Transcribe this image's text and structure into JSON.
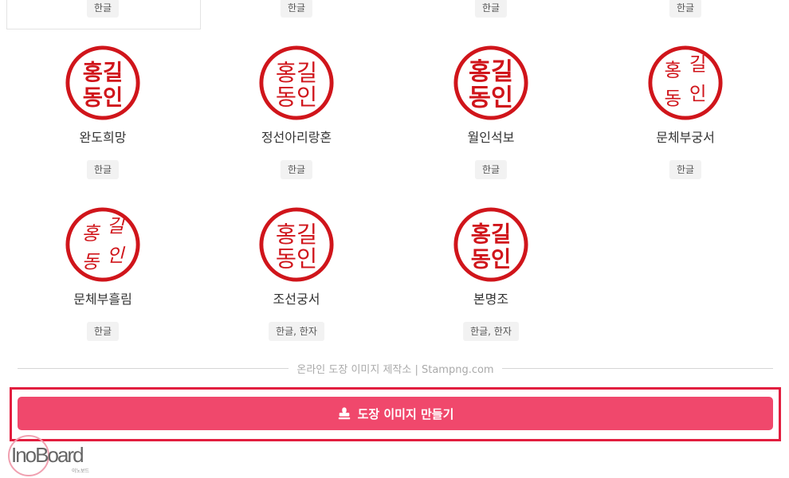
{
  "top_tags": [
    "한글",
    "한글",
    "한글",
    "한글"
  ],
  "stamp_glyphs": {
    "line1": "홍길",
    "line2": "동인",
    "c1": "홍",
    "c2": "길",
    "c3": "동",
    "c4": "인"
  },
  "stamps": [
    {
      "name": "완도희망",
      "tag": "한글",
      "style": "bold"
    },
    {
      "name": "정선아리랑혼",
      "tag": "한글",
      "style": "brush"
    },
    {
      "name": "월인석보",
      "tag": "한글",
      "style": "heavy"
    },
    {
      "name": "문체부궁서",
      "tag": "한글",
      "style": "split"
    },
    {
      "name": "문체부흘림",
      "tag": "한글",
      "style": "split"
    },
    {
      "name": "조선궁서",
      "tag": "한글, 한자",
      "style": "brush"
    },
    {
      "name": "본명조",
      "tag": "한글, 한자",
      "style": "bold"
    }
  ],
  "footer": {
    "caption": "온라인 도장 이미지 제작소 | Stampng.com"
  },
  "make_button": {
    "label": "도장 이미지 만들기",
    "icon": "stamp-icon"
  },
  "logo": {
    "text": "InoBoard",
    "sub": "이노보드"
  },
  "colors": {
    "stamp_red": "#d0151b",
    "button": "#f0486c",
    "highlight": "#e21e3f"
  }
}
